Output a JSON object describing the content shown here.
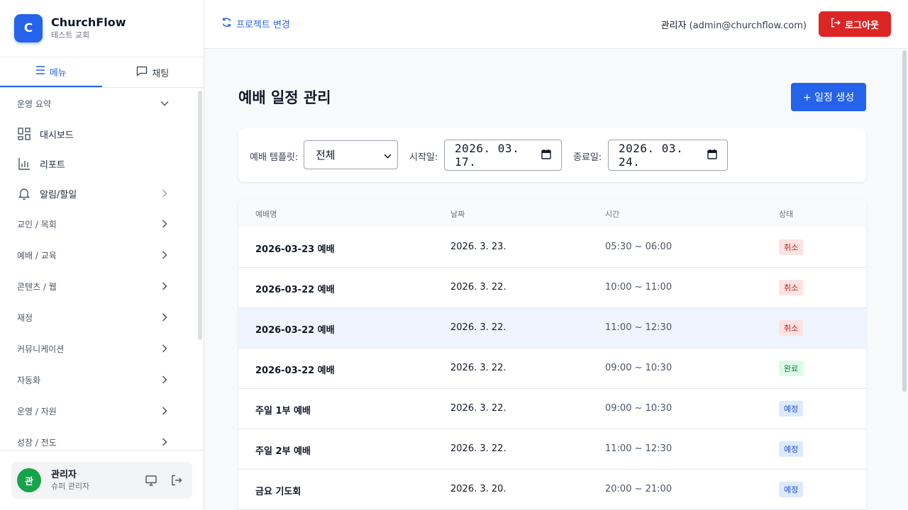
{
  "brand": {
    "logo_letter": "C",
    "name": "ChurchFlow",
    "subtitle": "테스트 교회"
  },
  "sidebar_tabs": [
    {
      "label": "메뉴",
      "icon": "list-icon",
      "active": true
    },
    {
      "label": "채팅",
      "icon": "chat-icon",
      "active": false
    }
  ],
  "menu": {
    "summary_group": "운영 요약",
    "items": [
      {
        "label": "대시보드",
        "icon": "dashboard-icon"
      },
      {
        "label": "리포트",
        "icon": "bar-chart-icon"
      },
      {
        "label": "알림/할일",
        "icon": "bell-icon"
      }
    ],
    "groups": [
      "교인 / 목회",
      "예배 / 교육",
      "콘텐츠 / 웹",
      "재정",
      "커뮤니케이션",
      "자동화",
      "운영 / 자원",
      "성장 / 전도"
    ]
  },
  "user": {
    "avatar": "관",
    "name": "관리자",
    "role": "슈퍼 관리자"
  },
  "topbar": {
    "switch_project": "프로젝트 변경",
    "admin_name": "관리자",
    "admin_email": "(admin@churchflow.com)",
    "logout": "로그아웃"
  },
  "page": {
    "title": "예배 일정 관리",
    "create_button": "+ 일정 생성"
  },
  "filters": {
    "template_label": "예배 템플릿:",
    "template_value": "전체",
    "start_label": "시작일:",
    "start_value": "2026. 03. 17.",
    "end_label": "종료일:",
    "end_value": "2026. 03. 24."
  },
  "table": {
    "headers": {
      "name": "예배명",
      "date": "날짜",
      "time": "시간",
      "status": "상태"
    },
    "rows": [
      {
        "name": "2026-03-23 예배",
        "date": "2026. 3. 23.",
        "time": "05:30 ~ 06:00",
        "status": "취소"
      },
      {
        "name": "2026-03-22 예배",
        "date": "2026. 3. 22.",
        "time": "10:00 ~ 11:00",
        "status": "취소"
      },
      {
        "name": "2026-03-22 예배",
        "date": "2026. 3. 22.",
        "time": "11:00 ~ 12:30",
        "status": "취소"
      },
      {
        "name": "2026-03-22 예배",
        "date": "2026. 3. 22.",
        "time": "09:00 ~ 10:30",
        "status": "완료"
      },
      {
        "name": "주일 1부 예배",
        "date": "2026. 3. 22.",
        "time": "09:00 ~ 10:30",
        "status": "예정"
      },
      {
        "name": "주일 2부 예배",
        "date": "2026. 3. 22.",
        "time": "11:00 ~ 12:30",
        "status": "예정"
      },
      {
        "name": "금요 기도회",
        "date": "2026. 3. 20.",
        "time": "20:00 ~ 21:00",
        "status": "예정"
      }
    ]
  },
  "colors": {
    "accent": "#2563eb",
    "danger": "#dc2626",
    "avatar": "#16a34a",
    "status_cancel_bg": "#fee2e2",
    "status_cancel_fg": "#b91c1c",
    "status_done_bg": "#dcfce7",
    "status_done_fg": "#15803d",
    "status_planned_bg": "#dbeafe",
    "status_planned_fg": "#1d4ed8"
  }
}
